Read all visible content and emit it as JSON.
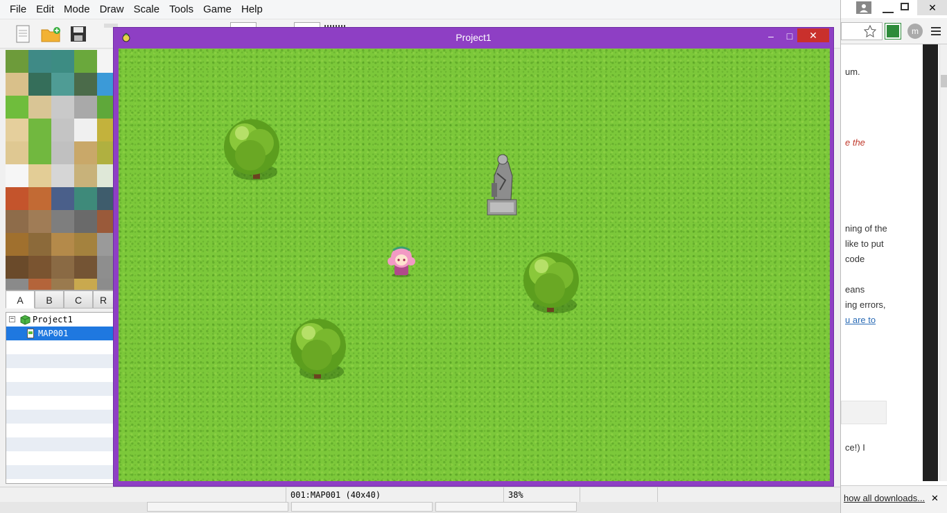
{
  "menu": [
    "File",
    "Edit",
    "Mode",
    "Draw",
    "Scale",
    "Tools",
    "Game",
    "Help"
  ],
  "tile_tabs": [
    "A",
    "B",
    "C",
    "R"
  ],
  "tree": {
    "root": "Project1",
    "map": "MAP001"
  },
  "status": {
    "map_info": "001:MAP001 (40x40)",
    "zoom": "38%"
  },
  "game": {
    "title": "Project1",
    "minimize": "–",
    "maximize": "□",
    "close": "✕"
  },
  "browser": {
    "lines": [
      "um.",
      "e the",
      "ning of the",
      "like to put",
      "code",
      "eans",
      "ing errors,",
      "u are to",
      "ce!) I"
    ],
    "download_link": "how all downloads...",
    "download_close": "✕"
  },
  "colors": {
    "game_frame": "#8e3fc4",
    "grass": "#7cc83a",
    "selection": "#1f78e0",
    "close_red": "#c9302c"
  }
}
